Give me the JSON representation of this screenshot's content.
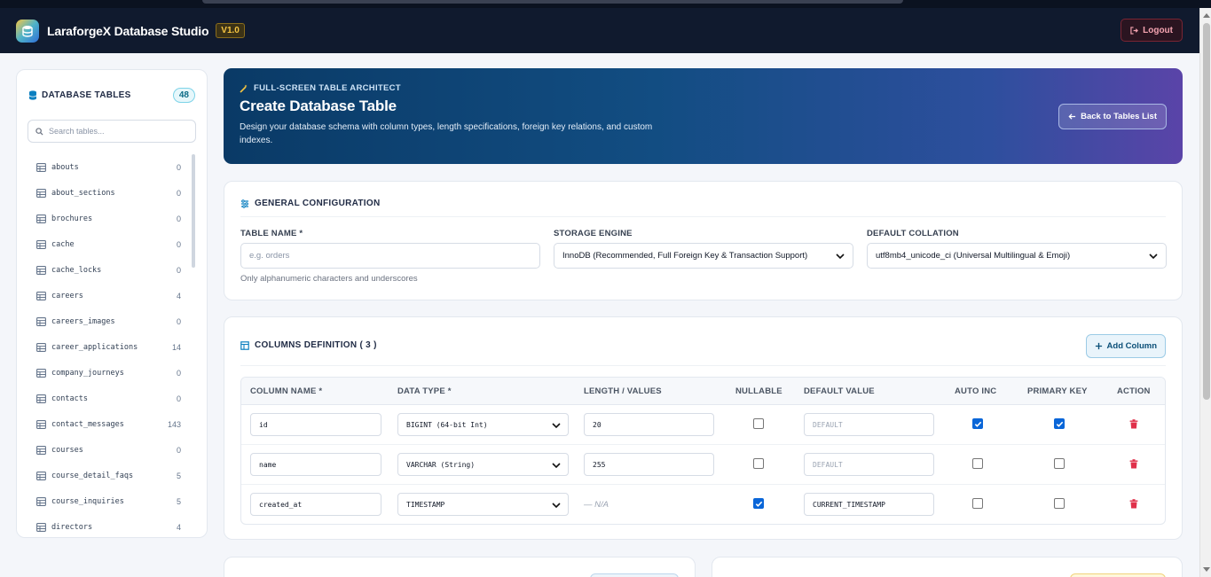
{
  "app": {
    "title": "LaraforgeX Database Studio",
    "version": "V1.0",
    "logout_label": "Logout"
  },
  "sidebar": {
    "title": "DATABASE TABLES",
    "count": "48",
    "search_placeholder": "Search tables...",
    "tables": [
      {
        "name": "abouts",
        "count": "0"
      },
      {
        "name": "about_sections",
        "count": "0"
      },
      {
        "name": "brochures",
        "count": "0"
      },
      {
        "name": "cache",
        "count": "0"
      },
      {
        "name": "cache_locks",
        "count": "0"
      },
      {
        "name": "careers",
        "count": "4"
      },
      {
        "name": "careers_images",
        "count": "0"
      },
      {
        "name": "career_applications",
        "count": "14"
      },
      {
        "name": "company_journeys",
        "count": "0"
      },
      {
        "name": "contacts",
        "count": "0"
      },
      {
        "name": "contact_messages",
        "count": "143"
      },
      {
        "name": "courses",
        "count": "0"
      },
      {
        "name": "course_detail_faqs",
        "count": "5"
      },
      {
        "name": "course_inquiries",
        "count": "5"
      },
      {
        "name": "directors",
        "count": "4"
      }
    ]
  },
  "hero": {
    "eyebrow": "FULL-SCREEN TABLE ARCHITECT",
    "title": "Create Database Table",
    "description": "Design your database schema with column types, length specifications, foreign key relations, and custom indexes.",
    "back_label": "Back to Tables List"
  },
  "general": {
    "title": "GENERAL CONFIGURATION",
    "table_name_label": "TABLE NAME *",
    "table_name_placeholder": "e.g. orders",
    "table_name_hint": "Only alphanumeric characters and underscores",
    "engine_label": "STORAGE ENGINE",
    "engine_value": "InnoDB (Recommended, Full Foreign Key & Transaction Support)",
    "collation_label": "DEFAULT COLLATION",
    "collation_value": "utf8mb4_unicode_ci (Universal Multilingual & Emoji)"
  },
  "columns": {
    "title": "COLUMNS DEFINITION ( 3 )",
    "add_label": "Add Column",
    "headers": {
      "name": "COLUMN NAME *",
      "type": "DATA TYPE *",
      "length": "LENGTH / VALUES",
      "nullable": "NULLABLE",
      "default": "DEFAULT VALUE",
      "auto_inc": "AUTO INC",
      "primary": "PRIMARY KEY",
      "action": "ACTION"
    },
    "rows": [
      {
        "name": "id",
        "type": "BIGINT (64-bit Int)",
        "length": "20",
        "nullable": false,
        "default": "",
        "default_placeholder": "DEFAULT",
        "auto_inc": true,
        "primary": true
      },
      {
        "name": "name",
        "type": "VARCHAR (String)",
        "length": "255",
        "nullable": false,
        "default": "",
        "default_placeholder": "DEFAULT",
        "auto_inc": false,
        "primary": false
      },
      {
        "name": "created_at",
        "type": "TIMESTAMP",
        "length_na": "— N/A",
        "nullable": true,
        "default": "CURRENT_TIMESTAMP",
        "auto_inc": false,
        "primary": false
      }
    ]
  },
  "colors": {
    "nav_bg": "#101a2e",
    "accent": "#0a66d8",
    "danger": "#e0314b",
    "version_badge": "#f5c542"
  }
}
